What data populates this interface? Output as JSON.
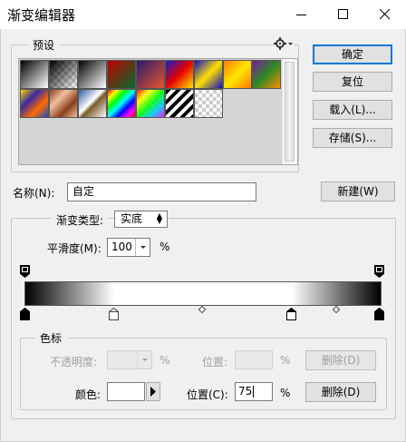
{
  "window": {
    "title": "渐变编辑器",
    "controls": {
      "minimize": "minimize-icon",
      "maximize": "maximize-icon",
      "close": "close-icon"
    }
  },
  "presets": {
    "label": "预设",
    "menu_icon": "gear-icon",
    "swatches": [
      "foreground-to-background",
      "foreground-to-transparent",
      "black-to-white",
      "red-green",
      "violet-orange",
      "blue-red-yellow",
      "blue-yellow-blue",
      "orange-yellow-orange",
      "violet-green-orange",
      "yellow-violet-orange-blue",
      "copper",
      "chrome",
      "spectrum",
      "transparent-rainbow",
      "transparent-stripes",
      "transparent-checker"
    ]
  },
  "buttons": {
    "ok": "确定",
    "reset": "复位",
    "load": "载入(L)...",
    "save": "存储(S)...",
    "new": "新建(W)"
  },
  "name": {
    "label": "名称(N):",
    "value": "自定"
  },
  "gradient": {
    "type_label": "渐变类型:",
    "type_value": "实底",
    "smoothness_label": "平滑度(M):",
    "smoothness_value": "100",
    "smoothness_unit": "%"
  },
  "stops": {
    "group_label": "色标",
    "opacity_label": "不透明度:",
    "opacity_unit": "%",
    "opacity_location_label": "位置:",
    "opacity_location_unit": "%",
    "opacity_delete": "删除(D)",
    "color_label": "颜色:",
    "color_value": "#ffffff",
    "color_location_label": "位置(C):",
    "color_location_value": "75",
    "color_location_unit": "%",
    "color_delete": "删除(D)"
  },
  "colors": {
    "accent": "#0078d7",
    "disabled_text": "#a0a0a0"
  }
}
